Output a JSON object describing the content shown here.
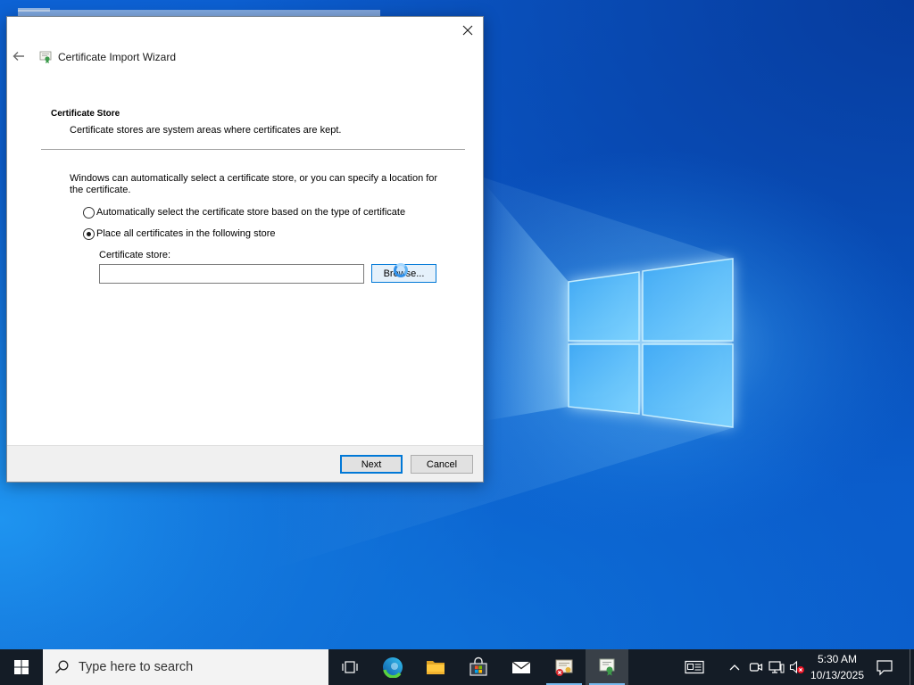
{
  "dialog": {
    "title": "Certificate Import Wizard",
    "title_icon": "certificate-wizard-icon",
    "section_title": "Certificate Store",
    "section_subtitle": "Certificate stores are system areas where certificates are kept.",
    "description": "Windows can automatically select a certificate store, or you can specify a location for the certificate.",
    "options": [
      {
        "label": "Automatically select the certificate store based on the type of certificate",
        "selected": false
      },
      {
        "label": "Place all certificates in the following store",
        "selected": true
      }
    ],
    "store_label": "Certificate store:",
    "store_value": "",
    "browse_label": "Browse...",
    "next_label": "Next",
    "cancel_label": "Cancel"
  },
  "taskbar": {
    "search_placeholder": "Type here to search",
    "apps": [
      {
        "icon": "task-view-icon",
        "running": false,
        "active": false
      },
      {
        "icon": "edge-icon",
        "running": false,
        "active": false
      },
      {
        "icon": "file-explorer-icon",
        "running": false,
        "active": false
      },
      {
        "icon": "microsoft-store-icon",
        "running": false,
        "active": false
      },
      {
        "icon": "mail-icon",
        "running": false,
        "active": false
      },
      {
        "icon": "certificate-manager-icon",
        "running": true,
        "active": false
      },
      {
        "icon": "certificate-import-wizard-icon",
        "running": true,
        "active": true
      }
    ],
    "tray_icons": [
      "news-icon",
      "chevron-up-icon",
      "meet-now-icon",
      "network-icon",
      "volume-muted-icon",
      "notification-icon"
    ],
    "clock": {
      "time": "5:30 AM",
      "date": "10/13/2025"
    }
  },
  "colors": {
    "taskbar_bg": "#141c26",
    "accent": "#0078d7",
    "footer_bg": "#f0f0f0",
    "running_indicator": "#76b9ed"
  }
}
